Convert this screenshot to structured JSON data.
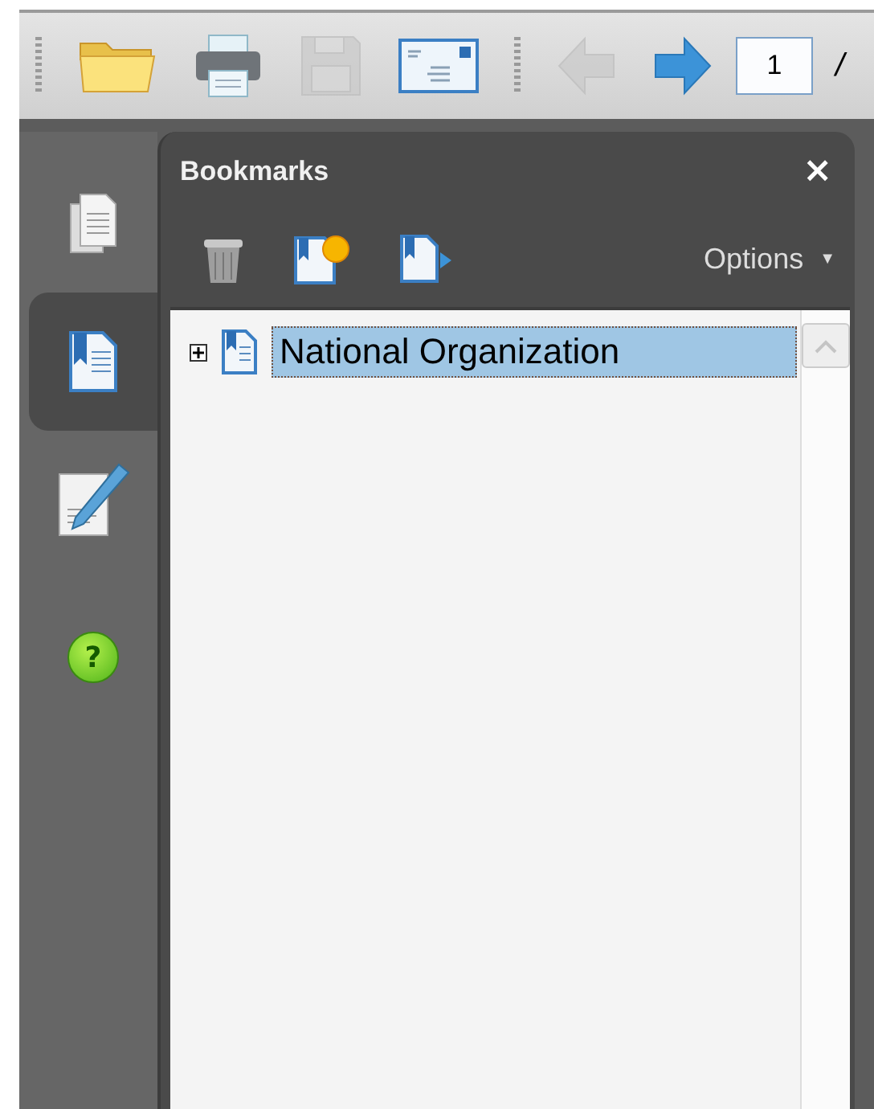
{
  "toolbar": {
    "buttons": [
      {
        "kind": "open",
        "disabled": false
      },
      {
        "kind": "print",
        "disabled": false
      },
      {
        "kind": "save",
        "disabled": true
      },
      {
        "kind": "email",
        "disabled": false
      },
      {
        "kind": "back",
        "disabled": true
      },
      {
        "kind": "forward",
        "disabled": false
      }
    ],
    "page_field": {
      "value": "1"
    },
    "page_separator": "/"
  },
  "nav": [
    {
      "kind": "pages",
      "selected": false
    },
    {
      "kind": "bookmarks",
      "selected": true
    },
    {
      "kind": "signatures",
      "selected": false
    },
    {
      "kind": "help",
      "selected": false,
      "label": "?"
    }
  ],
  "panel": {
    "title": "Bookmarks",
    "close": "×",
    "tools": [
      {
        "kind": "delete"
      },
      {
        "kind": "new"
      },
      {
        "kind": "move"
      }
    ],
    "options": {
      "label": "Options",
      "caret": "▼"
    }
  },
  "tree": [
    {
      "label": "National Organization",
      "expanded": false,
      "selected": true
    }
  ]
}
